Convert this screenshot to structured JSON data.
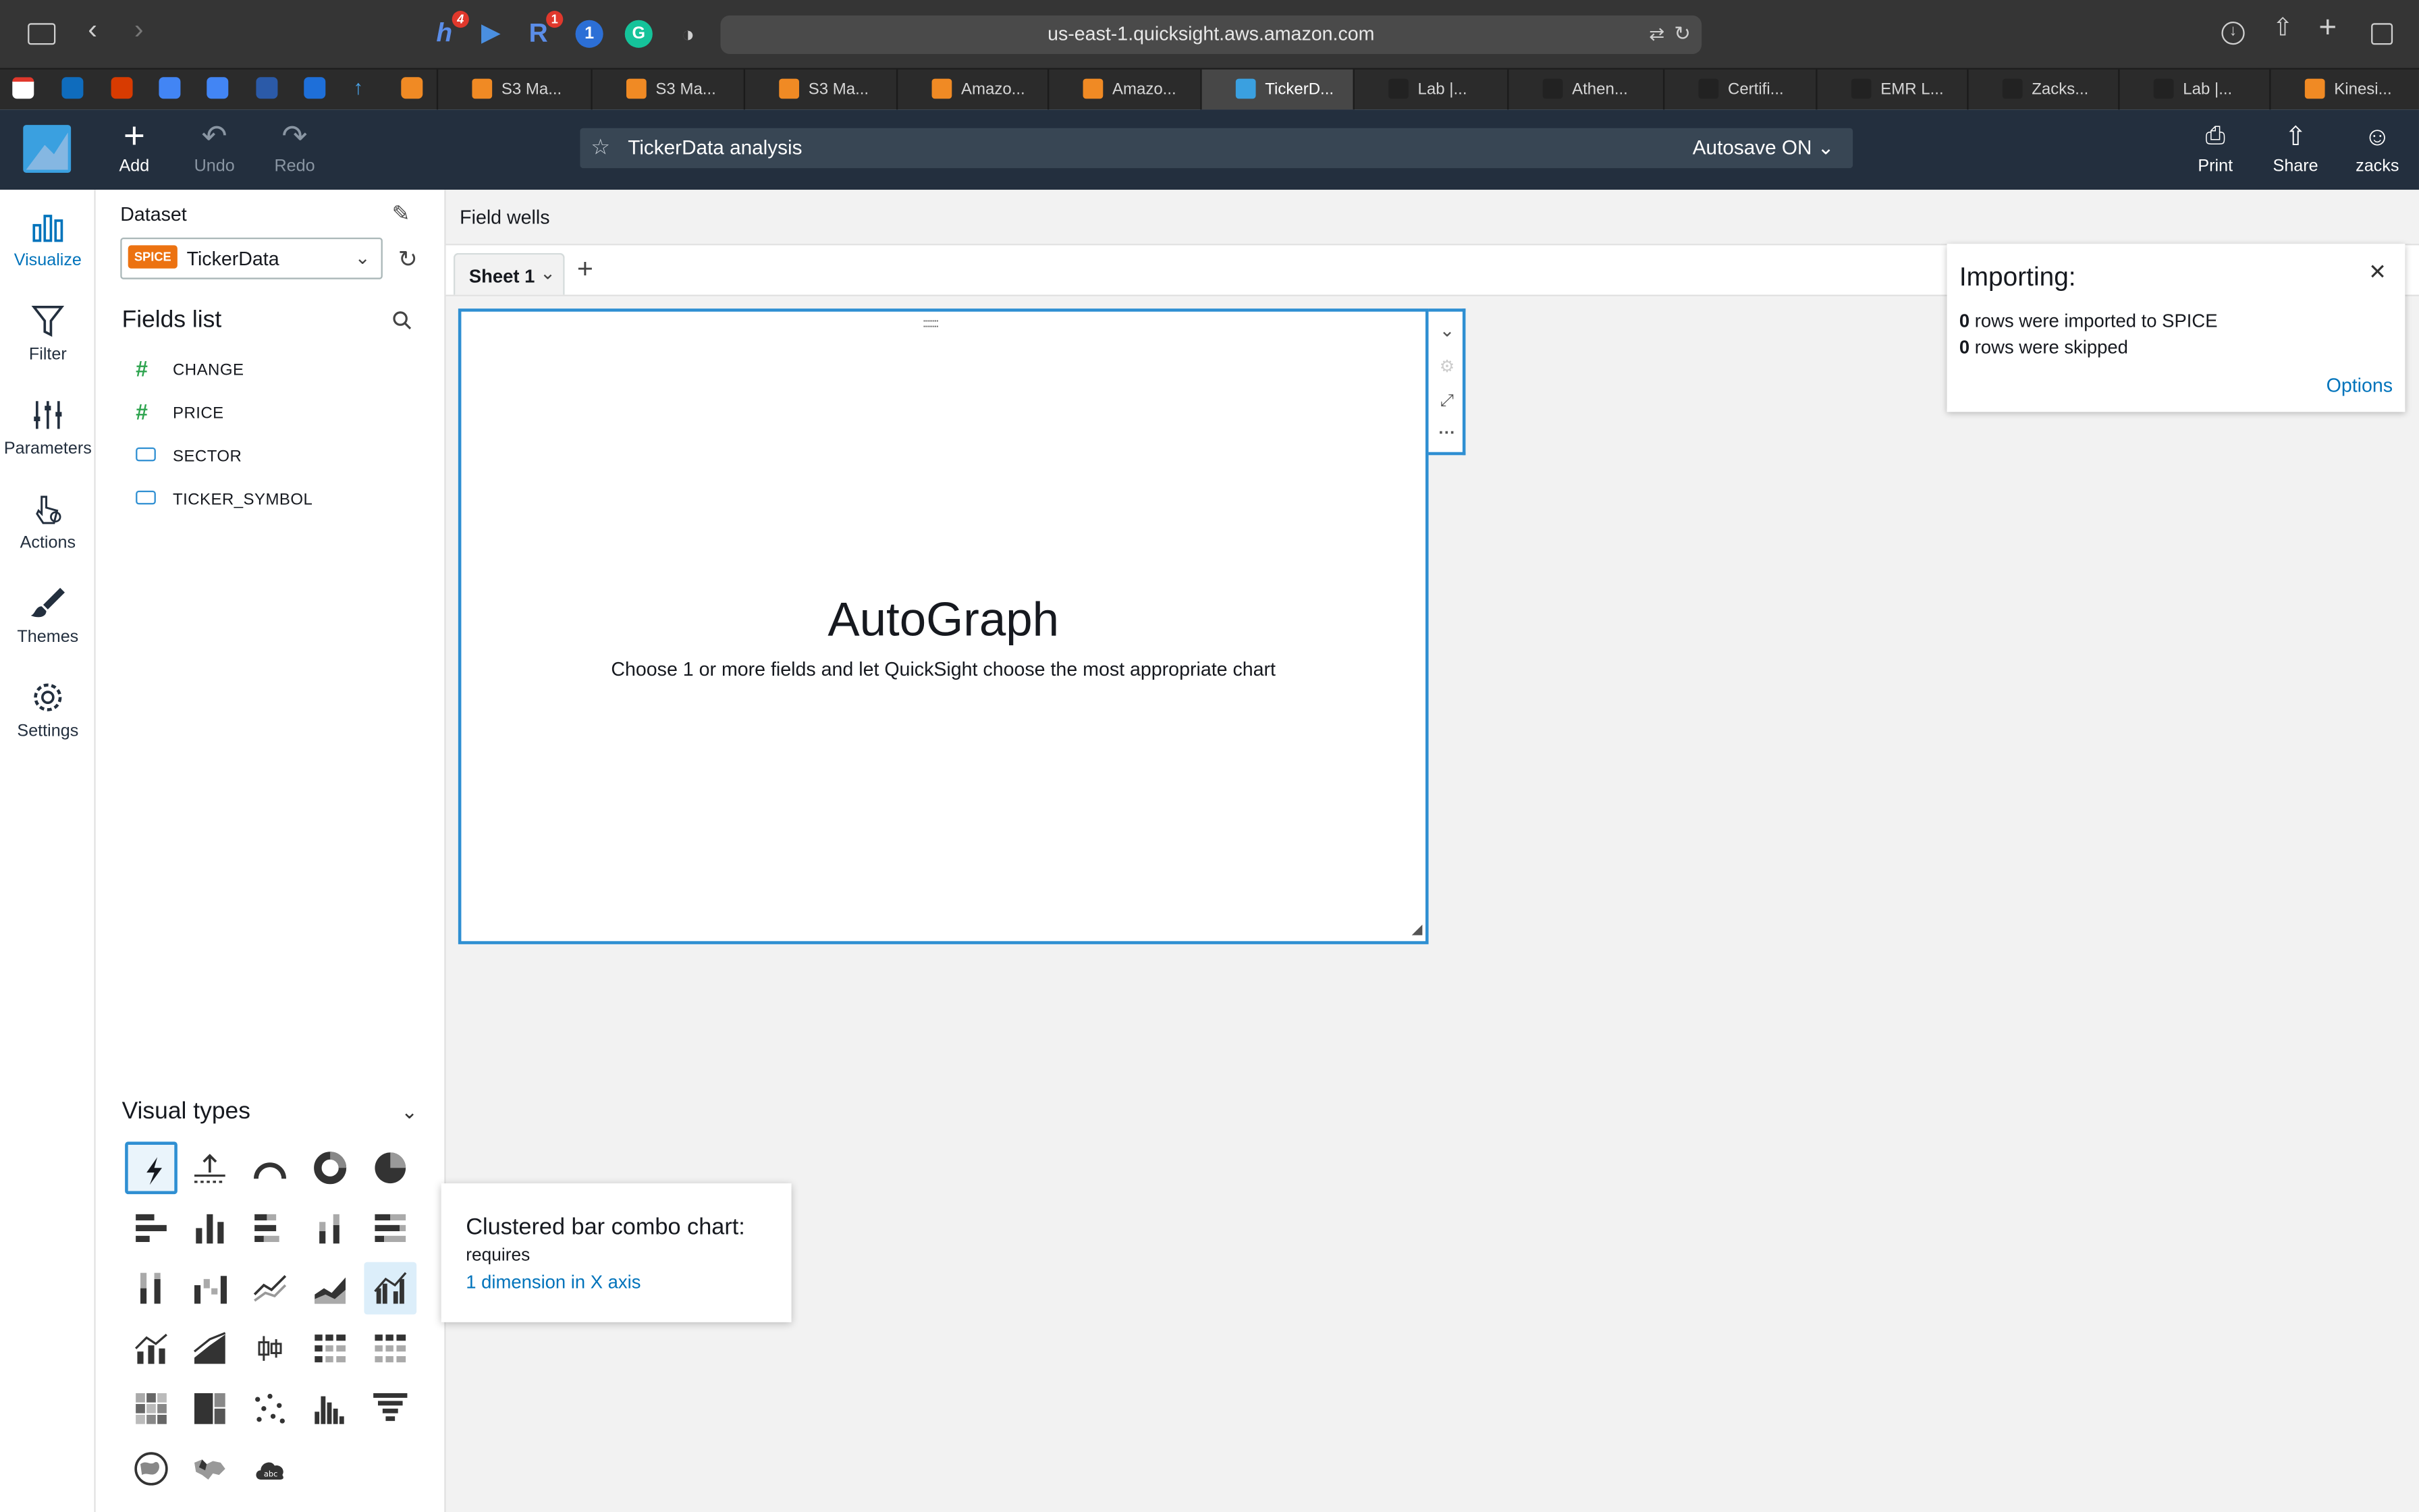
{
  "browser": {
    "url": "us-east-1.quicksight.aws.amazon.com",
    "ext_badges": [
      "4",
      "1"
    ],
    "tabs": [
      "S3 Ma...",
      "S3 Ma...",
      "S3 Ma...",
      "Amazo...",
      "Amazo...",
      "TickerD...",
      "Lab |...",
      "Athen...",
      "Certifi...",
      "EMR L...",
      "Zacks...",
      "Lab |...",
      "Kinesi..."
    ],
    "active_tab_index": 5
  },
  "header": {
    "add_label": "Add",
    "undo_label": "Undo",
    "redo_label": "Redo",
    "analysis_title": "TickerData analysis",
    "autosave_label": "Autosave ON",
    "print_label": "Print",
    "share_label": "Share",
    "user_label": "zacks"
  },
  "rail": {
    "items": [
      "Visualize",
      "Filter",
      "Parameters",
      "Actions",
      "Themes",
      "Settings"
    ],
    "active": "Visualize"
  },
  "dataset": {
    "label": "Dataset",
    "badge": "SPICE",
    "name": "TickerData"
  },
  "fields": {
    "title": "Fields list",
    "items": [
      {
        "name": "CHANGE",
        "type": "measure"
      },
      {
        "name": "PRICE",
        "type": "measure"
      },
      {
        "name": "SECTOR",
        "type": "dimension"
      },
      {
        "name": "TICKER_SYMBOL",
        "type": "dimension"
      }
    ]
  },
  "visual_types": {
    "title": "Visual types",
    "selected": "autograph-icon",
    "hovered": "clustered-bar-combo-icon"
  },
  "canvas": {
    "field_wells_label": "Field wells",
    "sheet_label": "Sheet 1",
    "autograph_title": "AutoGraph",
    "autograph_subtitle": "Choose 1 or more fields and let QuickSight choose the most appropriate chart"
  },
  "import_notice": {
    "title": "Importing:",
    "imported_count": "0",
    "imported_text": " rows were imported to SPICE",
    "skipped_count": "0",
    "skipped_text": " rows were skipped",
    "options_label": "Options"
  },
  "tooltip": {
    "title": "Clustered bar combo chart:",
    "requires": "requires",
    "requirement": "1 dimension in X axis"
  },
  "colors": {
    "accent": "#2f8fd2",
    "header_bg": "#232f3e",
    "spice": "#ec7211",
    "link": "#0073bb"
  }
}
